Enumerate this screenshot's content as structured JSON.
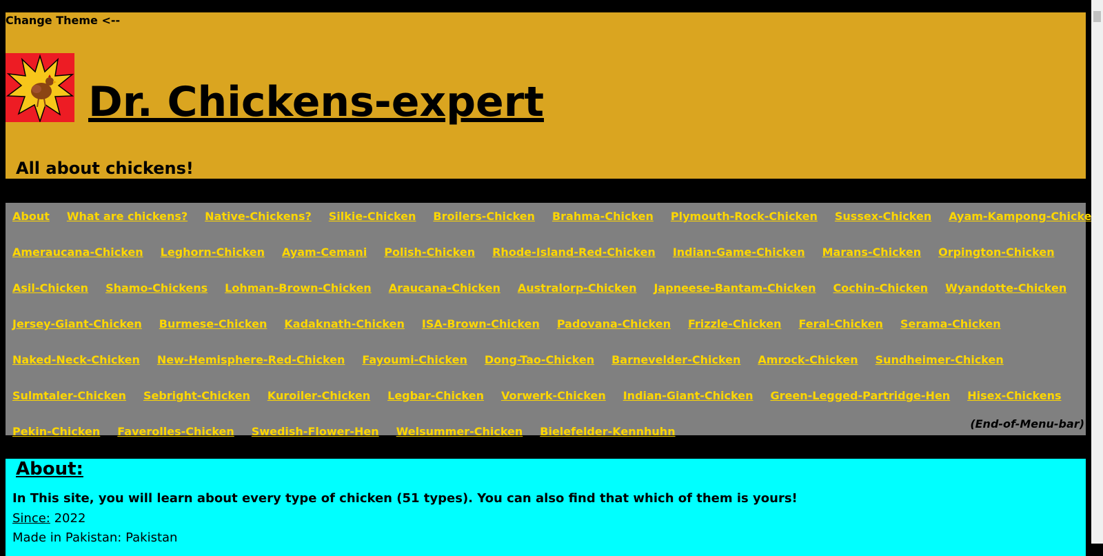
{
  "header": {
    "theme_toggle": "Change Theme <--",
    "title": "Dr. Chickens-expert",
    "tagline": "All about chickens!"
  },
  "menu": {
    "rows": [
      [
        "About",
        "What are chickens?",
        "Native-Chickens?",
        "Silkie-Chicken",
        "Broilers-Chicken",
        "Brahma-Chicken",
        "Plymouth-Rock-Chicken",
        "Sussex-Chicken",
        "Ayam-Kampong-Chicken"
      ],
      [
        "Ameraucana-Chicken",
        "Leghorn-Chicken",
        "Ayam-Cemani",
        "Polish-Chicken",
        "Rhode-Island-Red-Chicken",
        "Indian-Game-Chicken",
        "Marans-Chicken",
        "Orpington-Chicken"
      ],
      [
        "Asil-Chicken",
        "Shamo-Chickens",
        "Lohman-Brown-Chicken",
        "Araucana-Chicken",
        "Australorp-Chicken",
        "Japneese-Bantam-Chicken",
        "Cochin-Chicken",
        "Wyandotte-Chicken"
      ],
      [
        "Jersey-Giant-Chicken",
        "Burmese-Chicken",
        "Kadaknath-Chicken",
        "ISA-Brown-Chicken",
        "Padovana-Chicken",
        "Frizzle-Chicken",
        "Feral-Chicken",
        "Serama-Chicken"
      ],
      [
        "Naked-Neck-Chicken",
        "New-Hemisphere-Red-Chicken",
        "Fayoumi-Chicken",
        "Dong-Tao-Chicken",
        "Barnevelder-Chicken",
        "Amrock-Chicken",
        "Sundheimer-Chicken"
      ],
      [
        "Sulmtaler-Chicken",
        "Sebright-Chicken",
        "Kuroiler-Chicken",
        "Legbar-Chicken",
        "Vorwerk-Chicken",
        "Indian-Giant-Chicken",
        "Green-Legged-Partridge-Hen",
        "Hisex-Chickens"
      ],
      [
        "Pekin-Chicken",
        "Faverolles-Chicken",
        "Swedish-Flower-Hen",
        "Welsummer-Chicken",
        "Bielefelder-Kennhuhn"
      ]
    ],
    "end_marker": "(End-of-Menu-bar)"
  },
  "about": {
    "heading": "About:",
    "description": "In This site, you will learn about every type of chicken (51 types). You can also find that which of them is yours!",
    "since_label": "Since:",
    "since_value": " 2022",
    "made_in": "Made in Pakistan: Pakistan"
  },
  "colors": {
    "header_bg": "#DAA520",
    "menu_bg": "#808080",
    "menu_link": "#FFD700",
    "about_bg": "#00FFFF",
    "logo_bg": "#ED1C24",
    "logo_burst": "#F7C61A"
  },
  "icons": {
    "logo": "chicken-starburst-logo"
  }
}
